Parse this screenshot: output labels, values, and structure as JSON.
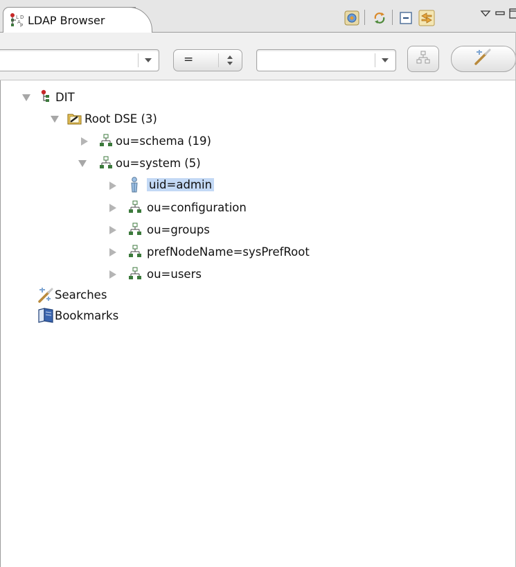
{
  "view": {
    "tab_title": "LDAP Browser",
    "icons": [
      "ldap-browser-icon",
      "link-with-editor-icon",
      "refresh-icon",
      "collapse-all-icon",
      "link-icon",
      "view-menu-icon",
      "minimize-icon",
      "maximize-icon"
    ]
  },
  "toolbar": {
    "attribute_combo": {
      "value": "",
      "placeholder": ""
    },
    "operator": "=",
    "value_combo": {
      "value": "",
      "placeholder": ""
    }
  },
  "tree": {
    "dit": "DIT",
    "root_dse": "Root DSE (3)",
    "schema": "ou=schema (19)",
    "system": "ou=system (5)",
    "children": [
      "uid=admin",
      "ou=configuration",
      "ou=groups",
      "prefNodeName=sysPrefRoot",
      "ou=users"
    ],
    "searches": "Searches",
    "bookmarks": "Bookmarks",
    "selected": "uid=admin"
  },
  "colors": {
    "selection": "#c3d9f5",
    "tab_border": "#8f8f8f",
    "toolbar_bg": "#f0f0f0"
  }
}
